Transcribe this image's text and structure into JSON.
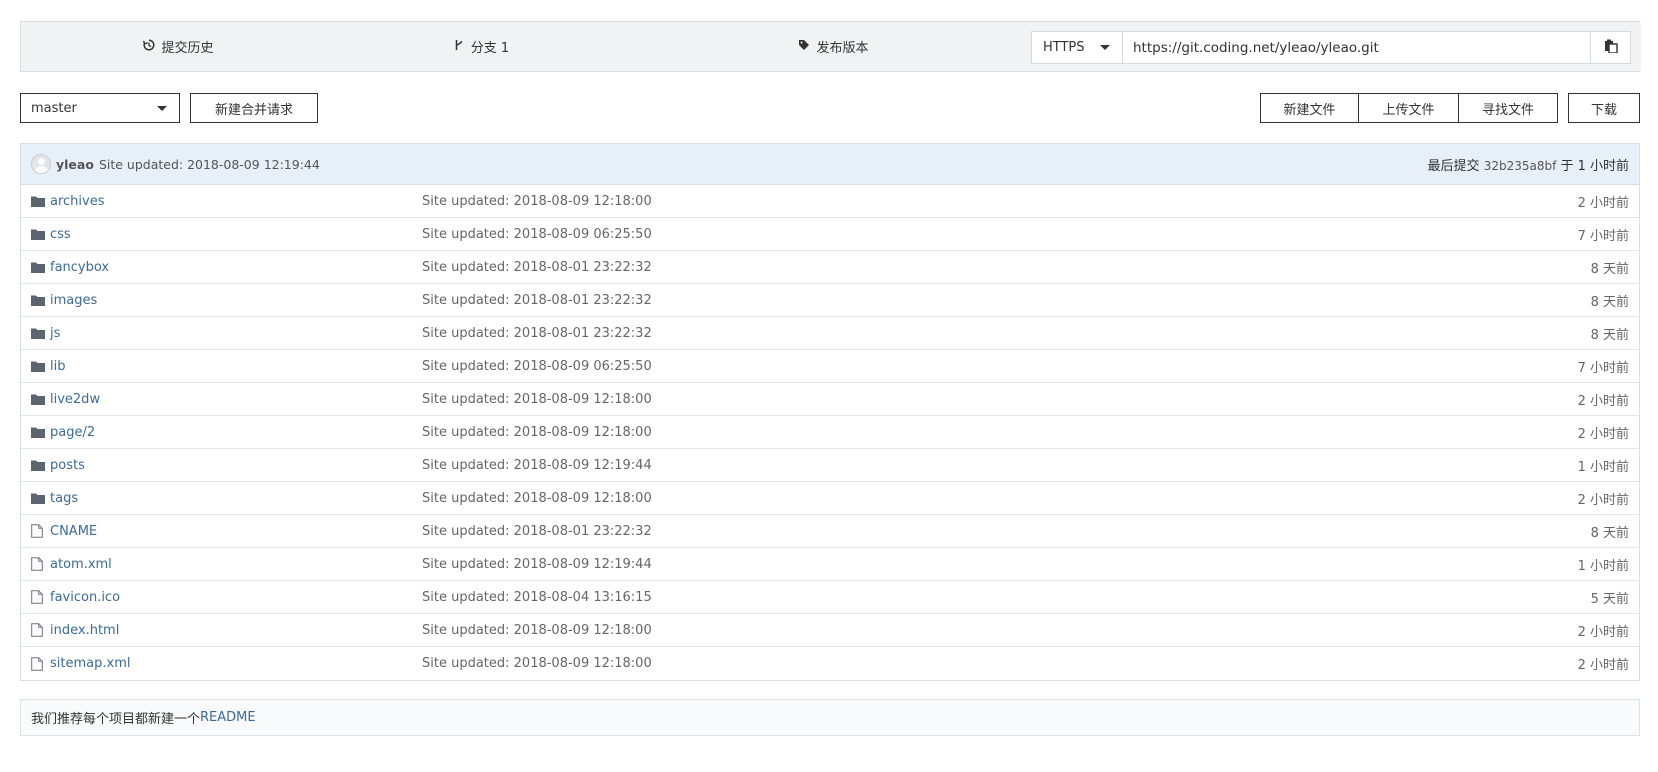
{
  "stats": {
    "commits_label": "提交历史",
    "branches_label": "分支 1",
    "releases_label": "发布版本"
  },
  "clone": {
    "protocol": "HTTPS",
    "url": "https://git.coding.net/yleao/yleao.git"
  },
  "toolbar": {
    "branch": "master",
    "new_mr_label": "新建合并请求",
    "new_file_label": "新建文件",
    "upload_file_label": "上传文件",
    "find_file_label": "寻找文件",
    "download_label": "下载"
  },
  "latest_commit": {
    "author": "yleao",
    "message": "Site updated: 2018-08-09 12:19:44",
    "last_commit_prefix": "最后提交",
    "hash": "32b235a8bf",
    "time": "于 1 小时前"
  },
  "files": [
    {
      "name": "archives",
      "type": "folder",
      "message": "Site updated: 2018-08-09 12:18:00",
      "time": "2 小时前"
    },
    {
      "name": "css",
      "type": "folder",
      "message": "Site updated: 2018-08-09 06:25:50",
      "time": "7 小时前"
    },
    {
      "name": "fancybox",
      "type": "folder",
      "message": "Site updated: 2018-08-01 23:22:32",
      "time": "8 天前"
    },
    {
      "name": "images",
      "type": "folder",
      "message": "Site updated: 2018-08-01 23:22:32",
      "time": "8 天前"
    },
    {
      "name": "js",
      "type": "folder",
      "message": "Site updated: 2018-08-01 23:22:32",
      "time": "8 天前"
    },
    {
      "name": "lib",
      "type": "folder",
      "message": "Site updated: 2018-08-09 06:25:50",
      "time": "7 小时前"
    },
    {
      "name": "live2dw",
      "type": "folder",
      "message": "Site updated: 2018-08-09 12:18:00",
      "time": "2 小时前"
    },
    {
      "name": "page/2",
      "type": "folder",
      "message": "Site updated: 2018-08-09 12:18:00",
      "time": "2 小时前"
    },
    {
      "name": "posts",
      "type": "folder",
      "message": "Site updated: 2018-08-09 12:19:44",
      "time": "1 小时前"
    },
    {
      "name": "tags",
      "type": "folder",
      "message": "Site updated: 2018-08-09 12:18:00",
      "time": "2 小时前"
    },
    {
      "name": "CNAME",
      "type": "file",
      "message": "Site updated: 2018-08-01 23:22:32",
      "time": "8 天前"
    },
    {
      "name": "atom.xml",
      "type": "file",
      "message": "Site updated: 2018-08-09 12:19:44",
      "time": "1 小时前"
    },
    {
      "name": "favicon.ico",
      "type": "file",
      "message": "Site updated: 2018-08-04 13:16:15",
      "time": "5 天前"
    },
    {
      "name": "index.html",
      "type": "file",
      "message": "Site updated: 2018-08-09 12:18:00",
      "time": "2 小时前"
    },
    {
      "name": "sitemap.xml",
      "type": "file",
      "message": "Site updated: 2018-08-09 12:18:00",
      "time": "2 小时前"
    }
  ],
  "readme_notice": {
    "text": "我们推荐每个项目都新建一个",
    "link": "README"
  },
  "colors": {
    "link": "#3d6a99",
    "header_bg": "#f0f2f4",
    "commit_bar_bg": "#e7f0f9"
  }
}
